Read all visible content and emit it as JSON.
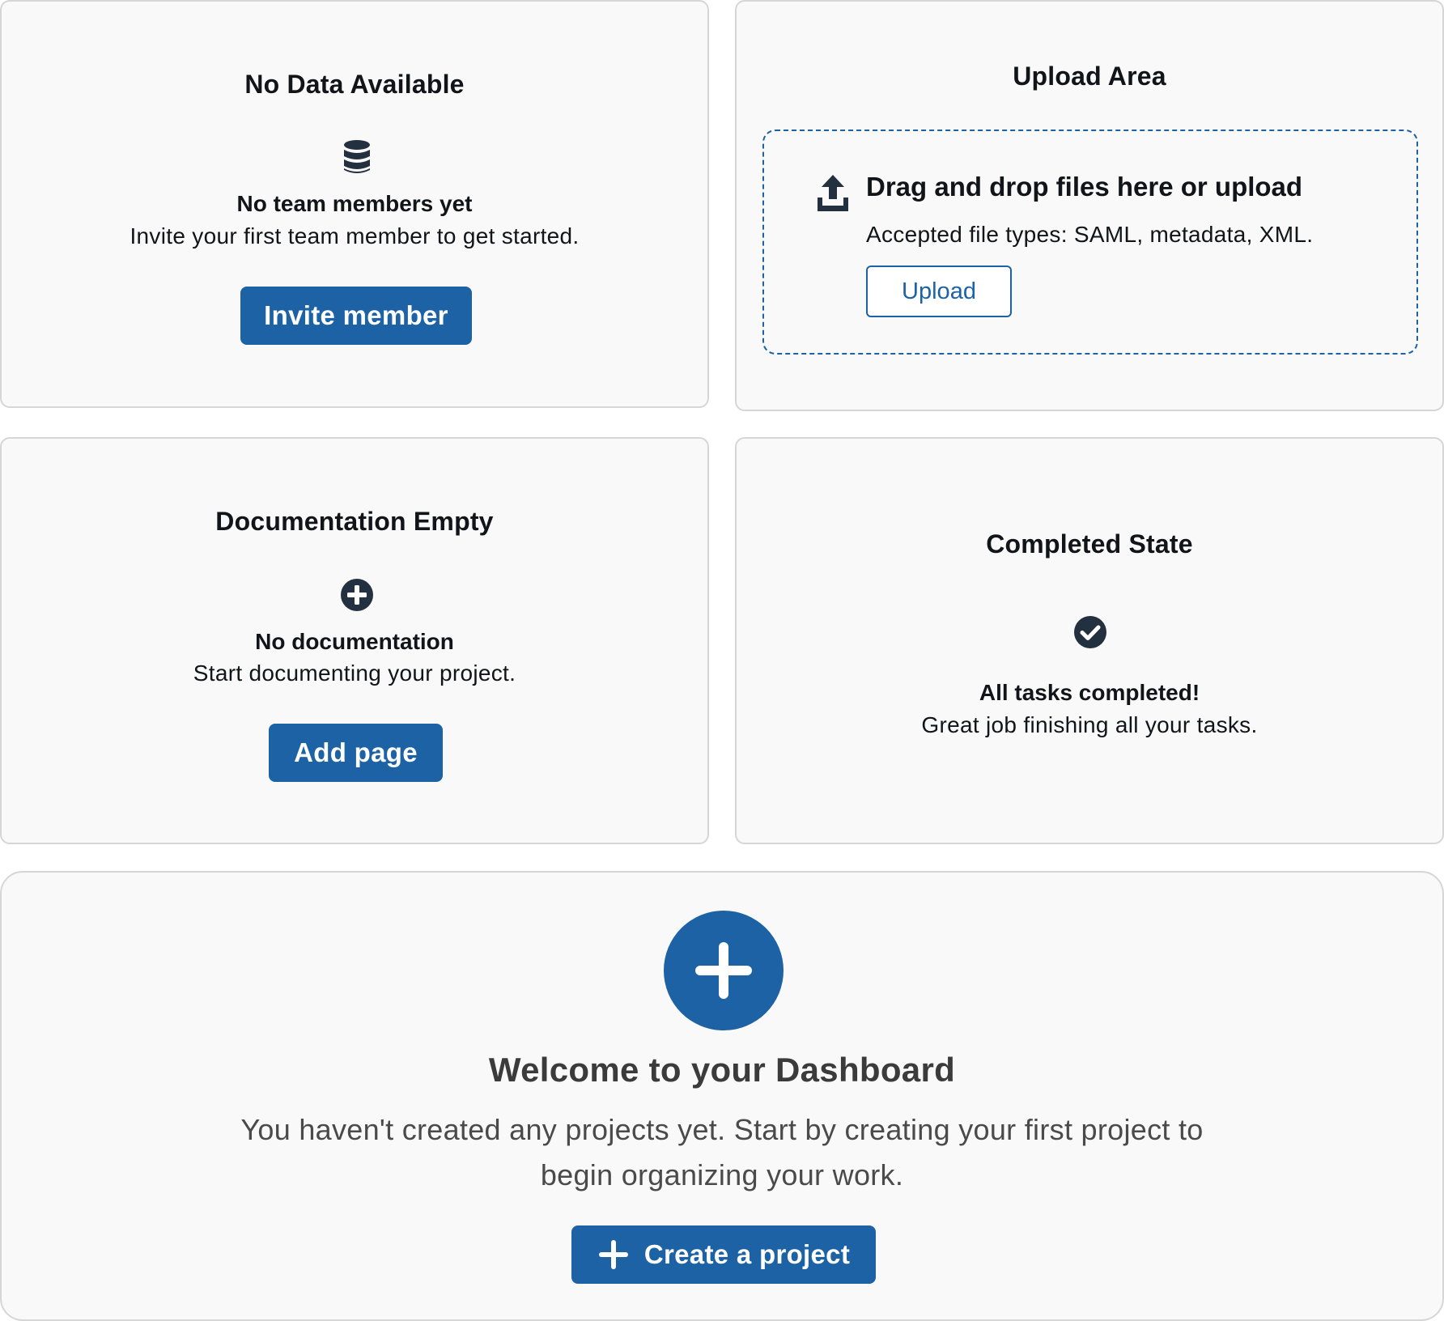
{
  "no_data_card": {
    "title": "No Data Available",
    "icon": "database-icon",
    "heading": "No team members yet",
    "text": "Invite your first team member to get started.",
    "button_label": "Invite member"
  },
  "upload_card": {
    "title": "Upload Area",
    "icon": "upload-icon",
    "heading": "Drag and drop files here or upload",
    "text": "Accepted file types: SAML, metadata, XML.",
    "button_label": "Upload"
  },
  "docs_card": {
    "title": "Documentation Empty",
    "icon": "plus-circle-icon",
    "heading": "No documentation",
    "text": "Start documenting your project.",
    "button_label": "Add page"
  },
  "completed_card": {
    "title": "Completed State",
    "icon": "check-circle-icon",
    "heading": "All tasks completed!",
    "text": "Great job finishing all your tasks."
  },
  "welcome_card": {
    "icon": "plus-icon",
    "title": "Welcome to your Dashboard",
    "text_line1": "You haven't created any projects yet. Start by creating your first project to",
    "text_line2": "begin organizing your work.",
    "button_label": "Create a project"
  },
  "colors": {
    "primary": "#1d62a5",
    "icon_dark": "#23303f",
    "card_background": "#f9f9f9",
    "card_border": "#d6d6d6"
  }
}
